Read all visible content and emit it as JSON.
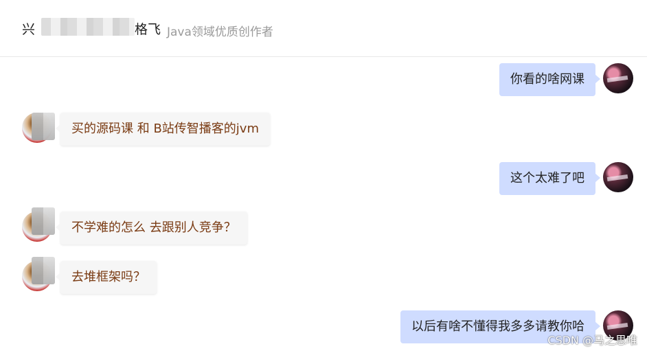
{
  "header": {
    "name_prefix": "兴",
    "name_suffix": "格飞",
    "subtitle": "Java领域优质创作者"
  },
  "messages": [
    {
      "side": "right",
      "text": "你看的啥网课"
    },
    {
      "side": "left",
      "text": "买的源码课 和 B站传智播客的jvm"
    },
    {
      "side": "right",
      "text": "这个太难了吧"
    },
    {
      "side": "left",
      "text": "不学难的怎么 去跟别人竞争？"
    },
    {
      "side": "left",
      "text": "去堆框架吗？"
    },
    {
      "side": "right",
      "text": "以后有啥不懂得我多多请教你哈"
    }
  ],
  "watermark": "CSDN @马之思唯",
  "colors": {
    "right_bubble": "#cfdcff",
    "left_bubble": "#f6f6f6",
    "left_text": "#7a3b13",
    "subtitle": "#9a9a9a"
  }
}
